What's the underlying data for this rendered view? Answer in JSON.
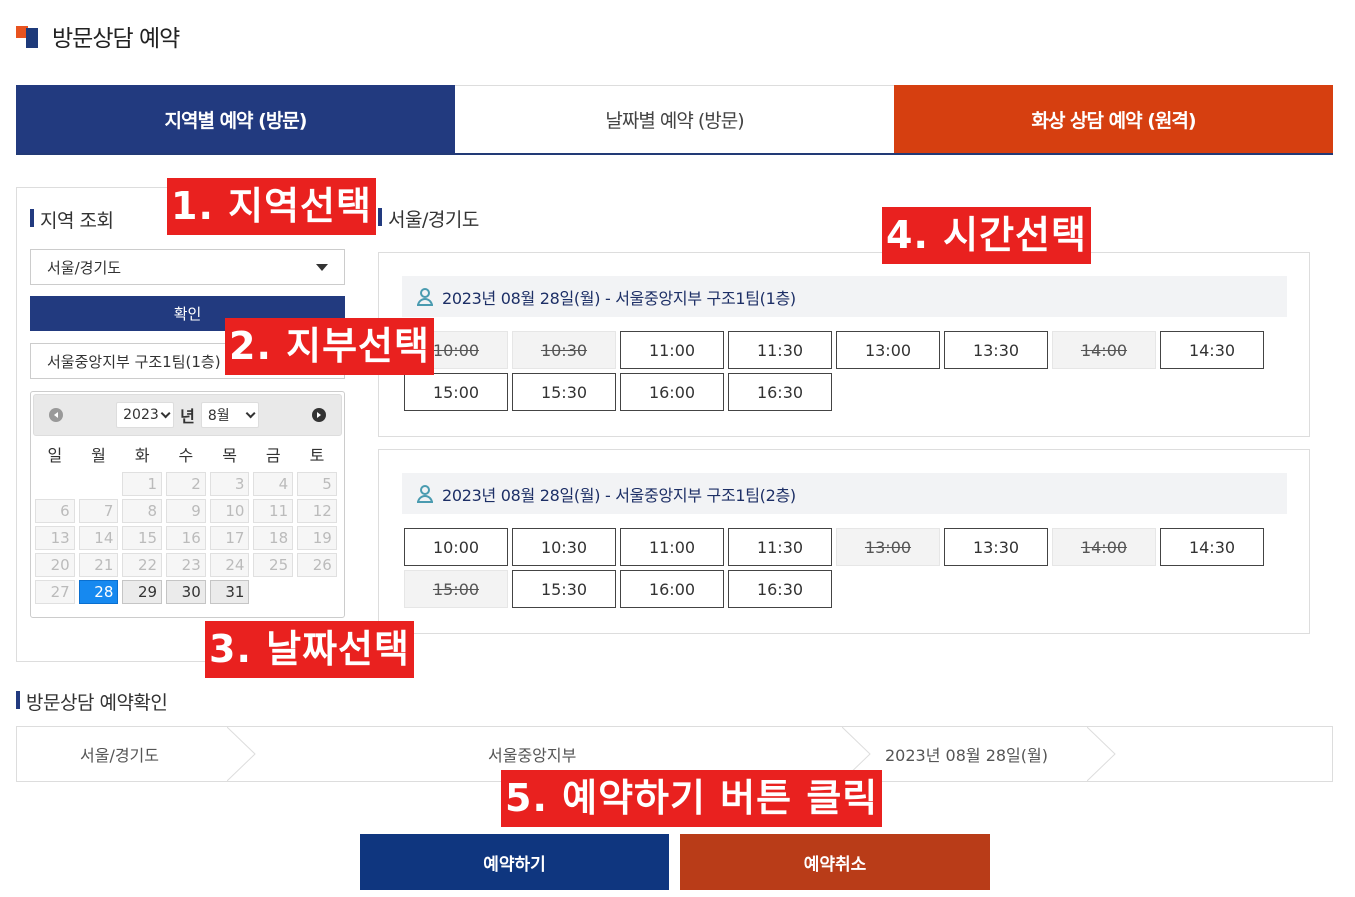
{
  "page": {
    "title": "방문상담 예약"
  },
  "tabs": [
    {
      "label": "지역별 예약 (방문)"
    },
    {
      "label": "날짜별 예약 (방문)"
    },
    {
      "label": "화상 상담 예약 (원격)"
    }
  ],
  "left": {
    "section_label": "지역 조회",
    "region_value": "서울/경기도",
    "confirm_label": "확인",
    "branch_value": "서울중앙지부 구조1팀(1층)"
  },
  "calendar": {
    "year": "2023",
    "year_suffix": "년",
    "month": "8월",
    "weekdays": [
      "일",
      "월",
      "화",
      "수",
      "목",
      "금",
      "토"
    ],
    "selected_day": "28"
  },
  "right": {
    "section_label": "서울/경기도",
    "boxes": [
      {
        "header": "2023년 08월 28일(월) - 서울중앙지부 구조1팀(1층)",
        "slots": [
          {
            "time": "10:00",
            "available": false
          },
          {
            "time": "10:30",
            "available": false
          },
          {
            "time": "11:00",
            "available": true
          },
          {
            "time": "11:30",
            "available": true
          },
          {
            "time": "13:00",
            "available": true
          },
          {
            "time": "13:30",
            "available": true
          },
          {
            "time": "14:00",
            "available": false
          },
          {
            "time": "14:30",
            "available": true
          },
          {
            "time": "15:00",
            "available": true
          },
          {
            "time": "15:30",
            "available": true
          },
          {
            "time": "16:00",
            "available": true
          },
          {
            "time": "16:30",
            "available": true
          }
        ]
      },
      {
        "header": "2023년 08월 28일(월) - 서울중앙지부 구조1팀(2층)",
        "slots": [
          {
            "time": "10:00",
            "available": true
          },
          {
            "time": "10:30",
            "available": true
          },
          {
            "time": "11:00",
            "available": true
          },
          {
            "time": "11:30",
            "available": true
          },
          {
            "time": "13:00",
            "available": false
          },
          {
            "time": "13:30",
            "available": true
          },
          {
            "time": "14:00",
            "available": false
          },
          {
            "time": "14:30",
            "available": true
          },
          {
            "time": "15:00",
            "available": false
          },
          {
            "time": "15:30",
            "available": true
          },
          {
            "time": "16:00",
            "available": true
          },
          {
            "time": "16:30",
            "available": true
          }
        ]
      }
    ]
  },
  "confirm": {
    "section_label": "방문상담 예약확인",
    "region": "서울/경기도",
    "branch": "서울중앙지부",
    "date": "2023년 08월 28일(월)"
  },
  "buttons": {
    "reserve": "예약하기",
    "cancel": "예약취소"
  },
  "annotations": {
    "step1": "1. 지역선택",
    "step2": "2. 지부선택",
    "step3": "3. 날짜선택",
    "step4": "4. 시간선택",
    "step5": "5. 예약하기 버튼 클릭"
  },
  "colors": {
    "navy": "#223a7f",
    "orange": "#d63f10",
    "annotation": "#e9211f",
    "selected_day": "#1689f0"
  }
}
